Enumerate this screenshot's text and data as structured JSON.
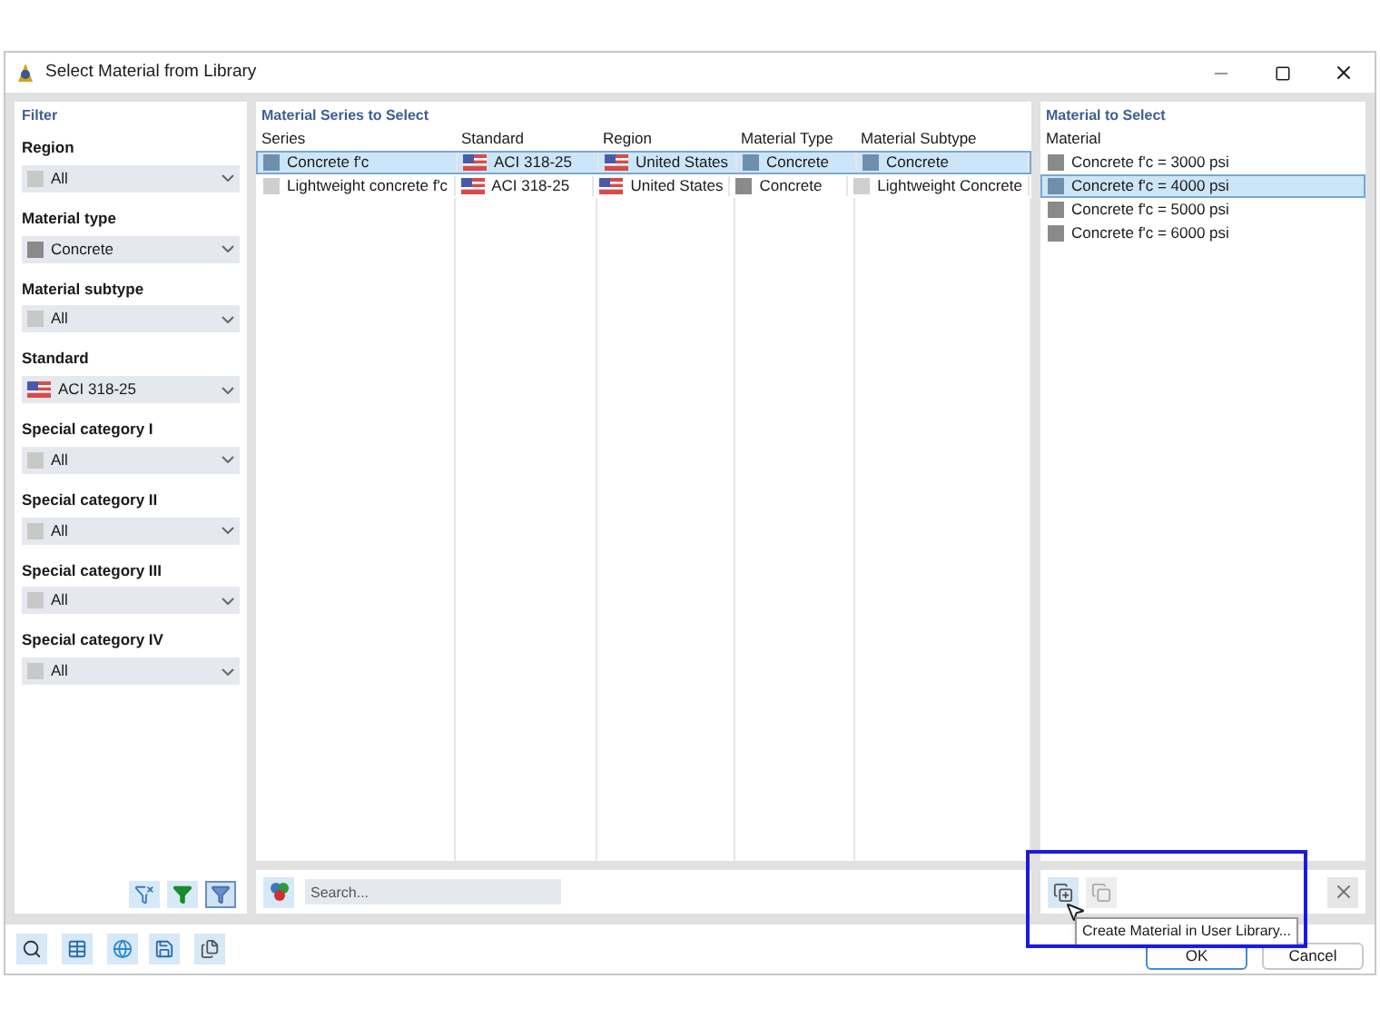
{
  "window": {
    "title": "Select Material from Library"
  },
  "filter": {
    "title": "Filter",
    "groups": [
      {
        "label": "Region",
        "value": "All",
        "kind": "swatch",
        "color": "#c8c8c8"
      },
      {
        "label": "Material type",
        "value": "Concrete",
        "kind": "swatch",
        "color": "#8a8a8a"
      },
      {
        "label": "Material subtype",
        "value": "All",
        "kind": "swatch",
        "color": "#c8c8c8"
      },
      {
        "label": "Standard",
        "value": "ACI 318-25",
        "kind": "flag"
      },
      {
        "label": "Special category I",
        "value": "All",
        "kind": "swatch",
        "color": "#c8c8c8"
      },
      {
        "label": "Special category II",
        "value": "All",
        "kind": "swatch",
        "color": "#c8c8c8"
      },
      {
        "label": "Special category III",
        "value": "All",
        "kind": "swatch",
        "color": "#c8c8c8"
      },
      {
        "label": "Special category IV",
        "value": "All",
        "kind": "swatch",
        "color": "#c8c8c8"
      }
    ],
    "buttons": [
      {
        "kind": "clear",
        "selected": false
      },
      {
        "kind": "apply",
        "selected": false
      },
      {
        "kind": "filter",
        "selected": true
      }
    ]
  },
  "series": {
    "title": "Material Series to Select",
    "columns": [
      "Series",
      "Standard",
      "Region",
      "Material Type",
      "Material Subtype"
    ],
    "rows": [
      {
        "selected": true,
        "cells": [
          {
            "text": "Concrete f'c",
            "kind": "swatch",
            "color": "#6e8fae"
          },
          {
            "text": "ACI 318-25",
            "kind": "flag"
          },
          {
            "text": "United States",
            "kind": "flag"
          },
          {
            "text": "Concrete",
            "kind": "swatch",
            "color": "#6e8fae"
          },
          {
            "text": "Concrete",
            "kind": "swatch",
            "color": "#6e8fae"
          }
        ]
      },
      {
        "selected": false,
        "cells": [
          {
            "text": "Lightweight concrete f'c",
            "kind": "swatch",
            "color": "#cfcfcf"
          },
          {
            "text": "ACI 318-25",
            "kind": "flag"
          },
          {
            "text": "United States",
            "kind": "flag"
          },
          {
            "text": "Concrete",
            "kind": "swatch",
            "color": "#8a8a8a"
          },
          {
            "text": "Lightweight Concrete",
            "kind": "swatch",
            "color": "#cfcfcf"
          }
        ]
      }
    ],
    "search": {
      "placeholder": "Search..."
    }
  },
  "materials": {
    "title": "Material to Select",
    "column": "Material",
    "rows": [
      {
        "text": "Concrete f'c = 3000 psi",
        "color": "#8a8a8a",
        "selected": false
      },
      {
        "text": "Concrete f'c = 4000 psi",
        "color": "#6e8fae",
        "selected": true
      },
      {
        "text": "Concrete f'c = 5000 psi",
        "color": "#8a8a8a",
        "selected": false
      },
      {
        "text": "Concrete f'c = 6000 psi",
        "color": "#8a8a8a",
        "selected": false
      }
    ]
  },
  "tooltip": "Create Material in User Library...",
  "buttons": [
    "OK",
    "Cancel"
  ]
}
